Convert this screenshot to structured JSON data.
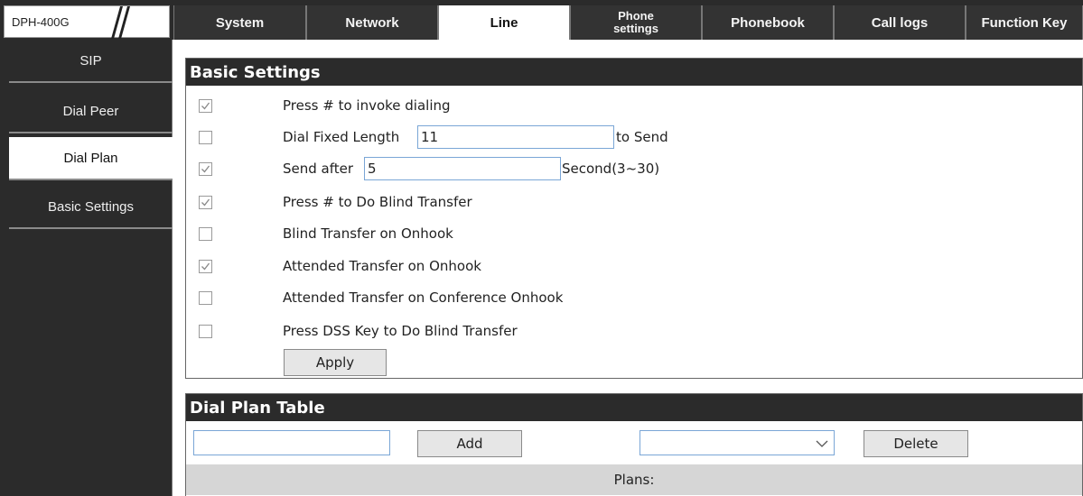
{
  "brand": {
    "model": "DPH-400G"
  },
  "tabs": [
    {
      "label": "System"
    },
    {
      "label": "Network"
    },
    {
      "label": "Line"
    },
    {
      "label": "Phone\nsettings"
    },
    {
      "label": "Phonebook"
    },
    {
      "label": "Call logs"
    },
    {
      "label": "Function Key"
    }
  ],
  "active_tab": "Line",
  "sidebar": {
    "items": [
      {
        "label": "SIP"
      },
      {
        "label": "Dial Peer"
      },
      {
        "label": "Dial Plan"
      },
      {
        "label": "Basic Settings"
      }
    ],
    "active": "Dial Plan"
  },
  "basic_settings": {
    "title": "Basic Settings",
    "rows": [
      {
        "checked": true,
        "label": "Press # to invoke dialing"
      },
      {
        "checked": false,
        "label": "Dial Fixed Length",
        "value": "11",
        "suffix": "to Send"
      },
      {
        "checked": true,
        "label": "Send after",
        "value": "5",
        "suffix": "Second(3~30)"
      },
      {
        "checked": true,
        "label": "Press # to Do Blind Transfer"
      },
      {
        "checked": false,
        "label": "Blind Transfer on Onhook"
      },
      {
        "checked": true,
        "label": "Attended Transfer on Onhook"
      },
      {
        "checked": false,
        "label": "Attended Transfer on Conference Onhook"
      },
      {
        "checked": false,
        "label": "Press DSS Key to Do Blind Transfer"
      }
    ],
    "apply_label": "Apply"
  },
  "dial_plan_table": {
    "title": "Dial Plan Table",
    "add_label": "Add",
    "delete_label": "Delete",
    "plans_label": "Plans:"
  },
  "colors": {
    "dark": "#2b2b2b",
    "input_border": "#7aa6d6",
    "plans_bg": "#d6d6d6"
  }
}
